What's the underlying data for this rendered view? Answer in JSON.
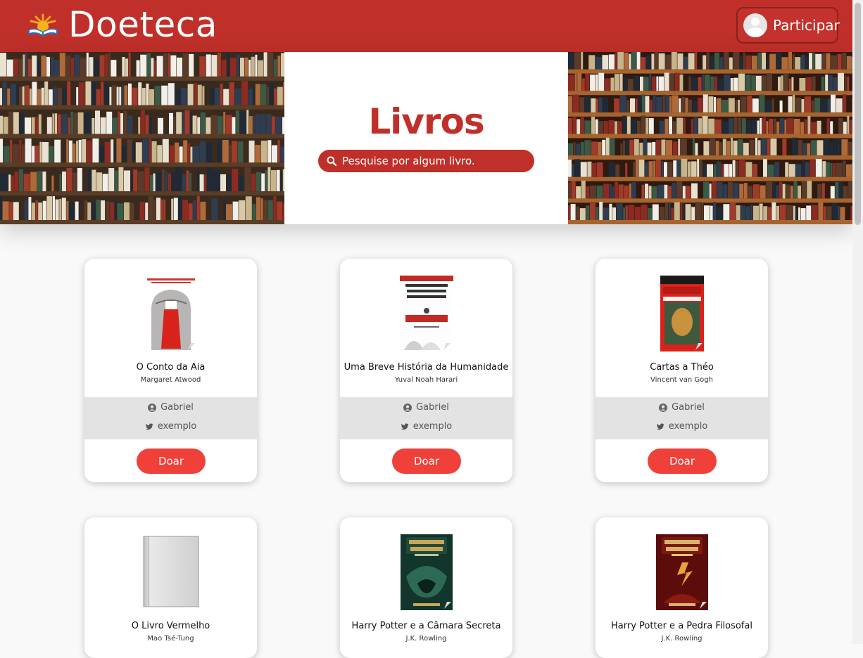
{
  "header": {
    "brand": "Doeteca",
    "join_label": "Participar"
  },
  "hero": {
    "title": "Livros",
    "search_placeholder": "Pesquise por algum livro."
  },
  "colors": {
    "primary": "#c0302a",
    "button": "#f0403a",
    "band": "#e3e3e3"
  },
  "books": [
    {
      "title": "O Conto da Aia",
      "author": "Margaret Atwood",
      "donor": "Gabriel",
      "twitter": "exemplo",
      "action": "Doar"
    },
    {
      "title": "Uma Breve História da Humanidade",
      "author": "Yuval Noah Harari",
      "donor": "Gabriel",
      "twitter": "exemplo",
      "action": "Doar"
    },
    {
      "title": "Cartas a Théo",
      "author": "Vincent van Gogh",
      "donor": "Gabriel",
      "twitter": "exemplo",
      "action": "Doar"
    },
    {
      "title": "O Livro Vermelho",
      "author": "Mao Tsé-Tung"
    },
    {
      "title": "Harry Potter e a Câmara Secreta",
      "author": "J.K. Rowling"
    },
    {
      "title": "Harry Potter e a Pedra Filosofal",
      "author": "J.K. Rowling"
    }
  ]
}
